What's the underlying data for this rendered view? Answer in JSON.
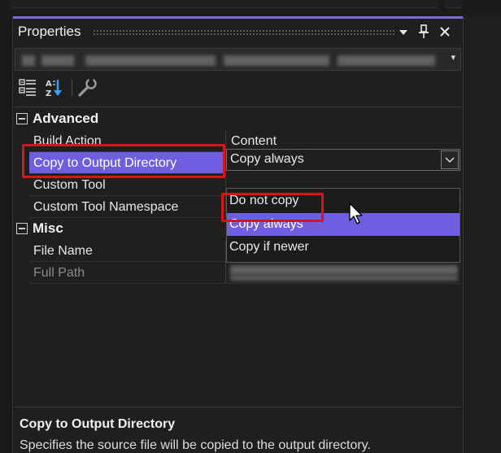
{
  "panel": {
    "title": "Properties",
    "pin_glyph": "📌",
    "close_glyph": "✕",
    "menu_glyph": "▼"
  },
  "object_selector": {
    "arrow": "▾"
  },
  "toolbar": {
    "categorized": "categorized-icon",
    "alphabetical": "alphabetical-icon",
    "property_pages": "wrench-icon"
  },
  "grid": {
    "categories": [
      {
        "name": "Advanced",
        "rows": [
          {
            "name": "Build Action",
            "value": "Content"
          },
          {
            "name": "Copy to Output Directory",
            "value": "Copy always"
          },
          {
            "name": "Custom Tool",
            "value": ""
          },
          {
            "name": "Custom Tool Namespace",
            "value": ""
          }
        ]
      },
      {
        "name": "Misc",
        "rows": [
          {
            "name": "File Name",
            "value": ""
          },
          {
            "name": "Full Path",
            "value": ""
          }
        ]
      }
    ]
  },
  "combo": {
    "value": "Copy always",
    "arrow": "⌵"
  },
  "dropdown": {
    "options": [
      "Do not copy",
      "Copy always",
      "Copy if newer"
    ],
    "selected": "Copy always"
  },
  "description": {
    "title": "Copy to Output Directory",
    "text": "Specifies the source file will be copied to the output directory."
  },
  "colors": {
    "accent": "#6e5fe0",
    "highlight": "#d9131a",
    "background": "#1f1f1f"
  }
}
